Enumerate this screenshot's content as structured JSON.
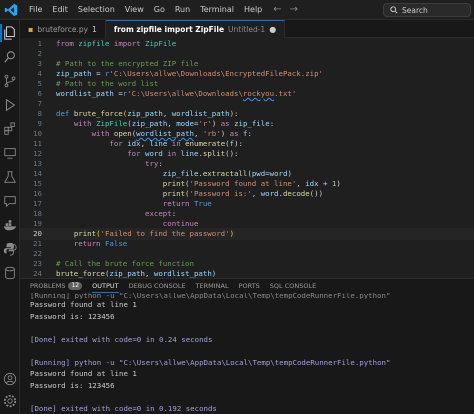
{
  "menu": [
    "File",
    "Edit",
    "Selection",
    "View",
    "Go",
    "Run",
    "Terminal",
    "Help"
  ],
  "search": {
    "placeholder": "Search"
  },
  "tabs": [
    {
      "label": "bruteforce.py",
      "dirty": "1",
      "active": false
    },
    {
      "label": "from zipfile import ZipFile",
      "sub": "Untitled-1",
      "active": true
    }
  ],
  "editor": {
    "current_line": 20,
    "lines": [
      {
        "n": "1",
        "html": "<span class='k'>from</span> <span class='cl'>zipfile</span> <span class='k'>import</span> <span class='cl'>ZipFile</span>"
      },
      {
        "n": "2",
        "html": ""
      },
      {
        "n": "3",
        "html": "<span class='c'># Path to the encrypted ZIP file</span>"
      },
      {
        "n": "4",
        "html": "<span class='v'>zip_path</span> <span class='p'>=</span> <span class='kb'>r</span><span class='s'>'C:\\Users\\allwe\\Downloads\\EncryptedFilePack.zip'</span>"
      },
      {
        "n": "5",
        "html": "<span class='c'># Path to the word list</span>"
      },
      {
        "n": "6",
        "html": "<span class='v'>wordlist_path</span> <span class='p'>=</span><span class='kb'>r</span><span class='s'>'C:\\Users\\allwe\\Downloads\\<span class=\"ul\">rockyou</span>.txt'</span>"
      },
      {
        "n": "7",
        "html": ""
      },
      {
        "n": "8",
        "html": "<span class='kb'>def</span> <span class='f'>brute_force</span><span class='br'>(</span><span class='v'>zip_path</span><span class='p'>, </span><span class='v'>wordlist_path</span><span class='br'>)</span><span class='p'>:</span>"
      },
      {
        "n": "9",
        "html": "    <span class='k'>with</span> <span class='cl'>ZipFile</span><span class='p'>(</span><span class='v'>zip_path</span><span class='p'>, </span><span class='v'>mode</span><span class='p'>=</span><span class='s'>'r'</span><span class='p'>)</span> <span class='k'>as</span> <span class='v'>zip_file</span><span class='p'>:</span>"
      },
      {
        "n": "10",
        "html": "        <span class='k'>with</span> <span class='f'>open</span><span class='p'>(</span><span class='v ul'>wordlist_path</span><span class='p'>, </span><span class='s'>'rb'</span><span class='p'>)</span> <span class='k'>as</span> <span class='v'>f</span><span class='p'>:</span>"
      },
      {
        "n": "11",
        "html": "            <span class='k'>for</span> <span class='v'>idx</span><span class='p'>, </span><span class='v'>line</span> <span class='k'>in</span> <span class='f'>enumerate</span><span class='p'>(</span><span class='v'>f</span><span class='p'>):</span>"
      },
      {
        "n": "12",
        "html": "                <span class='k'>for</span> <span class='v'>word</span> <span class='k'>in</span> <span class='v'>line</span><span class='p'>.</span><span class='f'>split</span><span class='p'>():</span>"
      },
      {
        "n": "13",
        "html": "                    <span class='k'>try</span><span class='p'>:</span>"
      },
      {
        "n": "14",
        "html": "                        <span class='v'>zip_file</span><span class='p'>.</span><span class='f'>extractall</span><span class='p'>(</span><span class='v'>pwd</span><span class='p'>=</span><span class='v'>word</span><span class='p'>)</span>"
      },
      {
        "n": "15",
        "html": "                        <span class='f'>print</span><span class='p'>(</span><span class='s'>'Password found at line'</span><span class='p'>, </span><span class='v'>idx</span> <span class='p'>+</span> <span class='n'>1</span><span class='p'>)</span>"
      },
      {
        "n": "16",
        "html": "                        <span class='f'>print</span><span class='p'>(</span><span class='s'>'Password is:'</span><span class='p'>, </span><span class='v'>word</span><span class='p'>.</span><span class='f'>decode</span><span class='p'>())</span>"
      },
      {
        "n": "17",
        "html": "                        <span class='k'>return</span> <span class='kb'>True</span>"
      },
      {
        "n": "18",
        "html": "                    <span class='k'>except</span><span class='p'>:</span>"
      },
      {
        "n": "19",
        "html": "                        <span class='k'>continue</span>"
      },
      {
        "n": "20",
        "html": "    <span class='f'>print</span><span class='br'>(</span><span class='s'>'Failed to find the password'</span><span class='br'>)</span>"
      },
      {
        "n": "21",
        "html": "    <span class='k'>return</span> <span class='kb'>False</span>"
      },
      {
        "n": "22",
        "html": ""
      },
      {
        "n": "23",
        "html": "<span class='c'># Call the brute force function</span>"
      },
      {
        "n": "24",
        "html": "<span class='f'>brute_force</span><span class='p'>(</span><span class='v'>zip_path</span><span class='p'>, </span><span class='v'>wordlist_path</span><span class='p'>)</span>"
      }
    ]
  },
  "panel": {
    "tabs": [
      {
        "label": "PROBLEMS",
        "badge": "12"
      },
      {
        "label": "OUTPUT",
        "active": true
      },
      {
        "label": "DEBUG CONSOLE"
      },
      {
        "label": "TERMINAL"
      },
      {
        "label": "PORTS"
      },
      {
        "label": "SQL CONSOLE"
      }
    ],
    "output": [
      {
        "kind": "clipped",
        "text": "[Running] python -u \"C:\\Users\\allwe\\AppData\\Local\\Temp\\tempCodeRunnerFile.python\""
      },
      {
        "kind": "text",
        "text": "Password found at line 1"
      },
      {
        "kind": "text",
        "text": "Password is: 123456"
      },
      {
        "kind": "blank",
        "text": ""
      },
      {
        "kind": "status",
        "text": "[Done] exited with code=0 in 0.24 seconds"
      },
      {
        "kind": "blank",
        "text": ""
      },
      {
        "kind": "status",
        "text": "[Running] python -u \"C:\\Users\\allwe\\AppData\\Local\\Temp\\tempCodeRunnerFile.python\""
      },
      {
        "kind": "text",
        "text": "Password found at line 1"
      },
      {
        "kind": "text",
        "text": "Password is: 123456"
      },
      {
        "kind": "blank",
        "text": ""
      },
      {
        "kind": "status",
        "text": "[Done] exited with code=0 in 0.192 seconds"
      }
    ]
  },
  "colors": {
    "accent": "#0078d4",
    "background": "#1e1e1e"
  },
  "icons": [
    "vscode-logo-icon",
    "explorer-icon",
    "search-icon",
    "source-control-icon",
    "run-debug-icon",
    "extensions-icon",
    "remote-icon",
    "testing-icon",
    "docker-icon",
    "python-icon",
    "database-icon",
    "account-icon",
    "settings-icon"
  ]
}
